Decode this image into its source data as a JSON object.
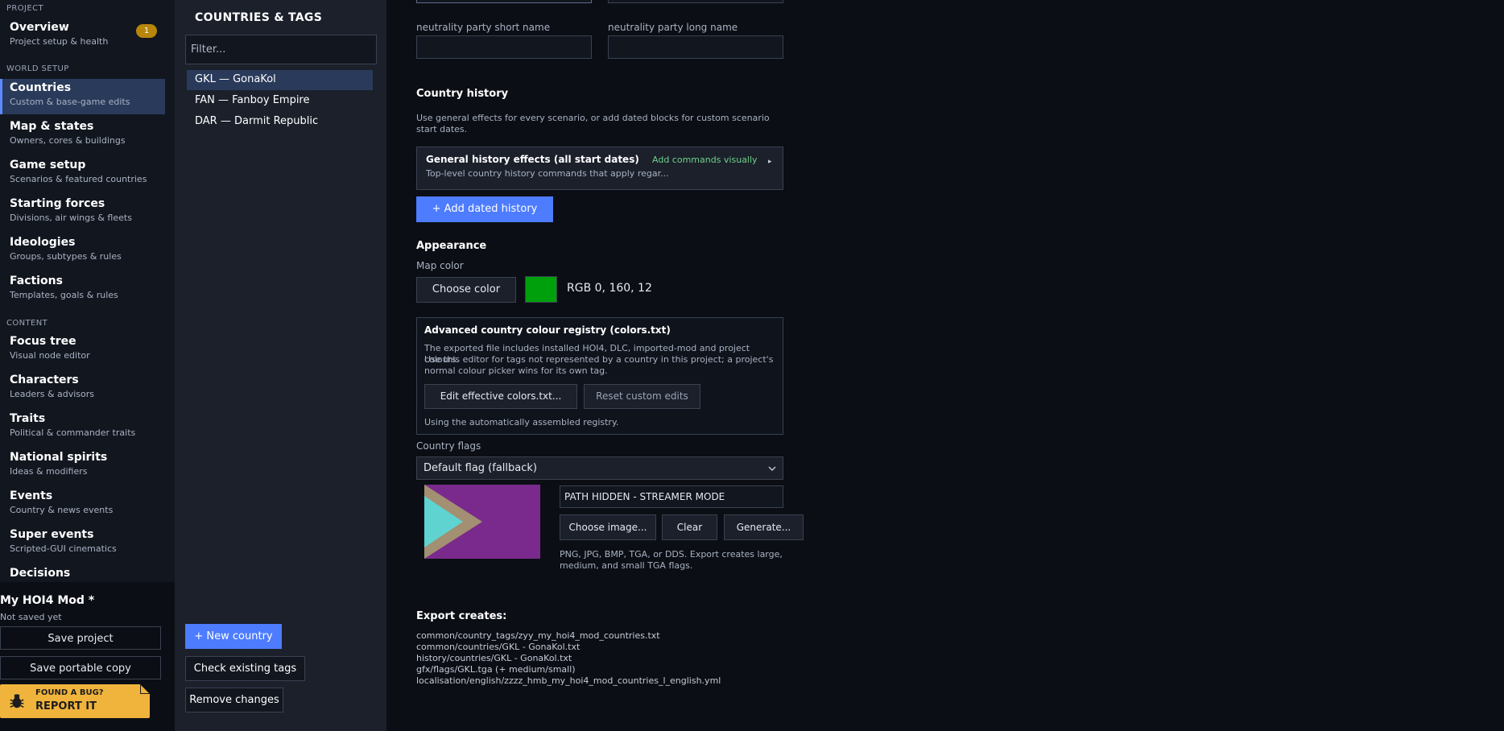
{
  "sidebar": {
    "section_project": "PROJECT",
    "section_world": "WORLD SETUP",
    "section_content": "CONTENT",
    "items": [
      {
        "title": "Overview",
        "subtitle": "Project setup & health",
        "badge": "1"
      },
      {
        "title": "Countries",
        "subtitle": "Custom & base-game edits",
        "active": true
      },
      {
        "title": "Map & states",
        "subtitle": "Owners, cores & buildings"
      },
      {
        "title": "Game setup",
        "subtitle": "Scenarios & featured countries"
      },
      {
        "title": "Starting forces",
        "subtitle": "Divisions, air wings & fleets"
      },
      {
        "title": "Ideologies",
        "subtitle": "Groups, subtypes & rules"
      },
      {
        "title": "Factions",
        "subtitle": "Templates, goals & rules"
      },
      {
        "title": "Focus tree",
        "subtitle": "Visual node editor"
      },
      {
        "title": "Characters",
        "subtitle": "Leaders & advisors"
      },
      {
        "title": "Traits",
        "subtitle": "Political & commander traits"
      },
      {
        "title": "National spirits",
        "subtitle": "Ideas & modifiers"
      },
      {
        "title": "Events",
        "subtitle": "Country & news events"
      },
      {
        "title": "Super events",
        "subtitle": "Scripted-GUI cinematics"
      },
      {
        "title": "Decisions",
        "subtitle": ""
      }
    ],
    "project_name": "My HOI4 Mod *",
    "project_status": "Not saved yet",
    "save_label": "Save project",
    "save_portable_label": "Save portable copy",
    "bug_line1": "FOUND A BUG?",
    "bug_line2": "REPORT IT"
  },
  "countries_panel": {
    "title": "COUNTRIES & TAGS",
    "filter_placeholder": "Filter...",
    "countries": [
      "GKL — GonaKol",
      "FAN — Fanboy Empire",
      "DAR — Darmit Republic"
    ],
    "new_country_label": "+ New country",
    "check_tags_label": "Check existing tags",
    "remove_changes_label": "Remove changes"
  },
  "editor": {
    "neutrality_short_label": "neutrality party short name",
    "neutrality_long_label": "neutrality party long name",
    "history": {
      "title": "Country history",
      "description": "Use general effects for every scenario, or add dated blocks for custom scenario start dates.",
      "general_title": "General history effects (all start dates)",
      "general_sub": "Top-level country history commands that apply regar...",
      "add_visual": "Add commands visually",
      "expand_icon": "triangle-right",
      "add_dated_label": "+ Add dated history"
    },
    "appearance": {
      "title": "Appearance",
      "map_color_label": "Map color",
      "choose_color_label": "Choose color",
      "swatch_color": "#00a00c",
      "rgb_text": "RGB 0, 160, 12"
    },
    "advanced": {
      "title": "Advanced country colour registry (colors.txt)",
      "desc_line1": "The exported file includes installed HOI4, DLC, imported-mod and project colours.",
      "desc_line2": "Use this editor for tags not represented by a country in this project; a project's",
      "desc_line3": "normal colour picker wins for its own tag.",
      "edit_label": "Edit effective colors.txt...",
      "reset_label": "Reset custom edits",
      "status": "Using the automatically assembled registry."
    },
    "flags": {
      "label": "Country flags",
      "selected": "Default flag (fallback)",
      "path_text": "PATH HIDDEN - STREAMER MODE",
      "choose_label": "Choose image...",
      "clear_label": "Clear",
      "generate_label": "Generate...",
      "formats_line1": "PNG, JPG, BMP, TGA, or DDS. Export creates large,",
      "formats_line2": "medium, and small TGA flags.",
      "flag_colors": {
        "background": "#7a2a8c",
        "chevron": "#a38f72",
        "triangle": "#5fd3d0"
      }
    },
    "export": {
      "title": "Export creates:",
      "files": [
        "common/country_tags/zyy_my_hoi4_mod_countries.txt",
        "common/countries/GKL - GonaKol.txt",
        "history/countries/GKL - GonaKol.txt",
        "gfx/flags/GKL.tga (+ medium/small)",
        "localisation/english/zzzz_hmb_my_hoi4_mod_countries_l_english.yml"
      ]
    }
  }
}
